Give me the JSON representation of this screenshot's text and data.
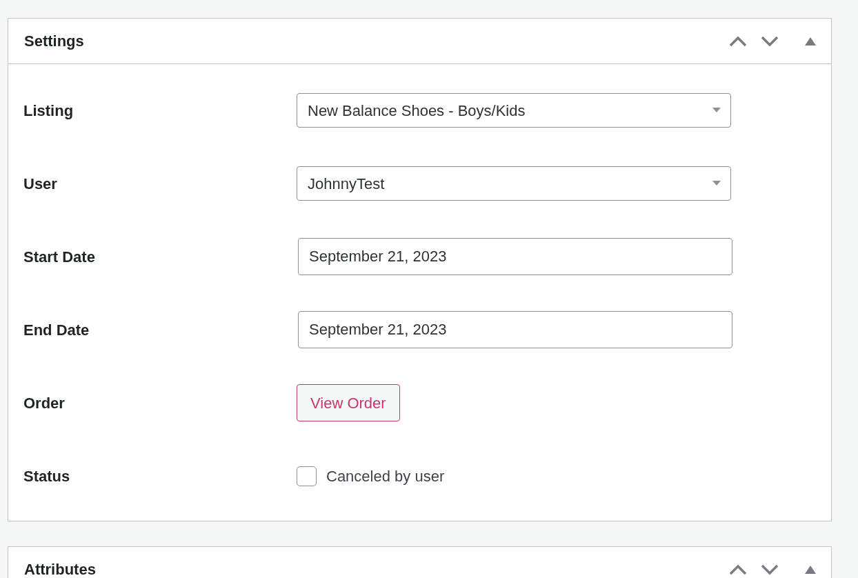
{
  "panels": [
    {
      "title": "Settings",
      "expanded": true,
      "rows": [
        {
          "label": "Listing",
          "kind": "select",
          "value": "New Balance Shoes - Boys/Kids"
        },
        {
          "label": "User",
          "kind": "select",
          "value": "JohnnyTest"
        },
        {
          "label": "Start Date",
          "kind": "text",
          "value": "September 21, 2023"
        },
        {
          "label": "End Date",
          "kind": "text",
          "value": "September 21, 2023"
        },
        {
          "label": "Order",
          "kind": "button",
          "value": "View Order"
        },
        {
          "label": "Status",
          "kind": "checkbox",
          "value": "Canceled by user",
          "checked": false
        }
      ]
    },
    {
      "title": "Attributes",
      "expanded": true
    }
  ]
}
